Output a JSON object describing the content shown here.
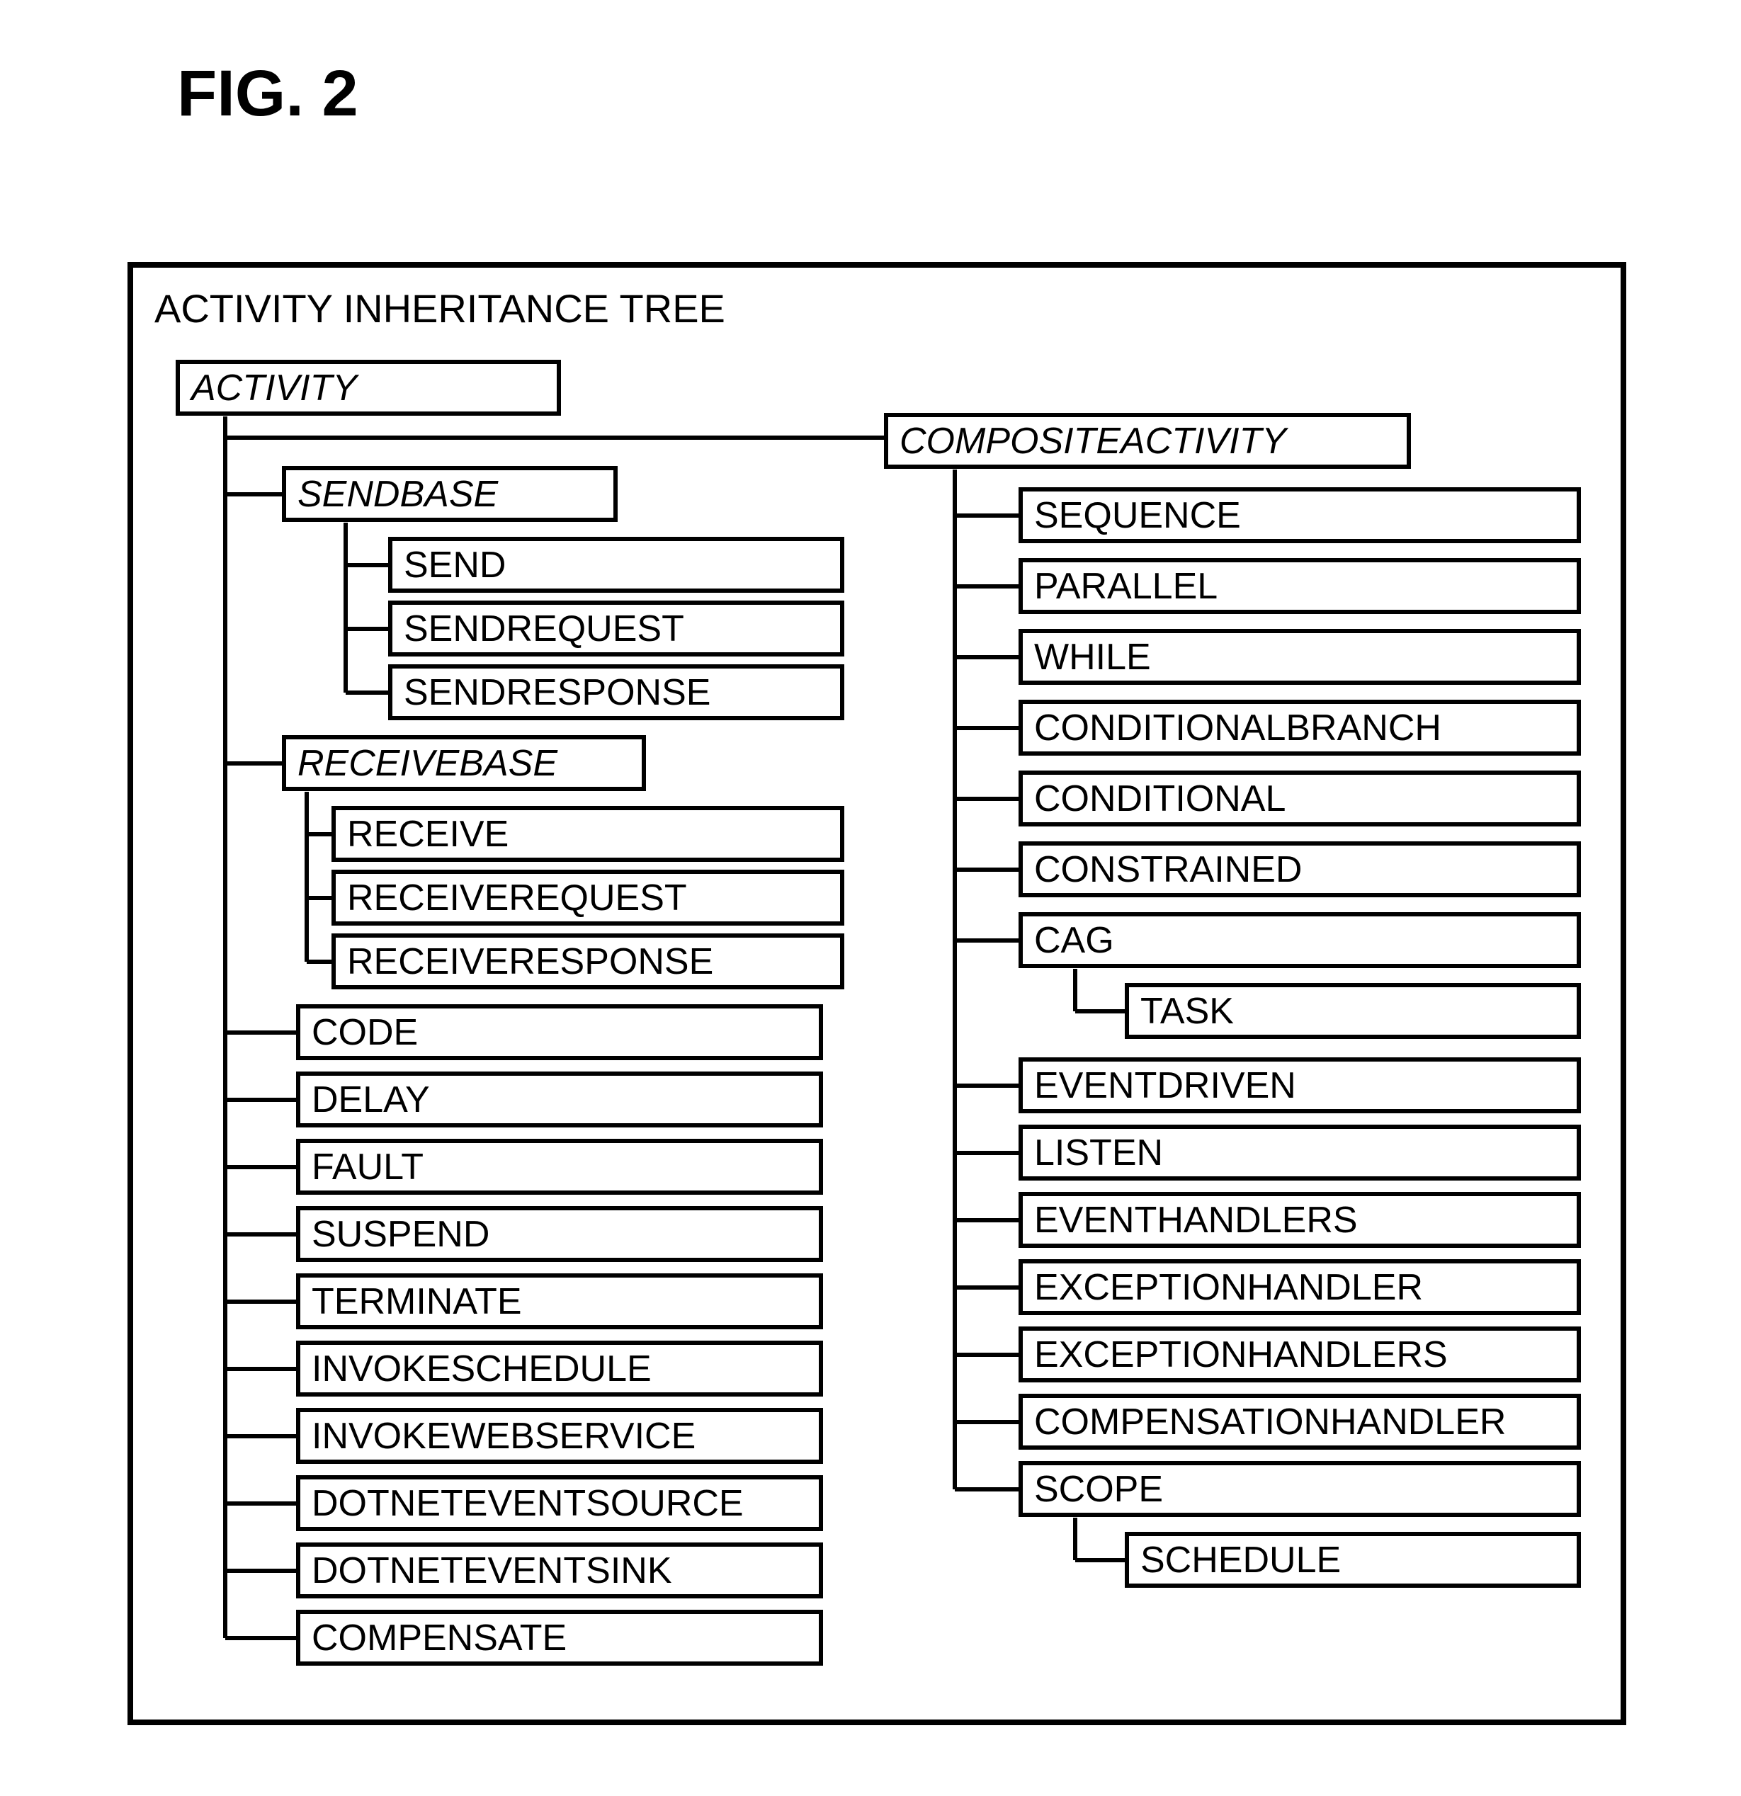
{
  "fig_label": "FIG. 2",
  "frame_title": "ACTIVITY INHERITANCE TREE",
  "activity": "ACTIVITY",
  "sendbase": "SENDBASE",
  "send": "SEND",
  "sendrequest": "SENDREQUEST",
  "sendresponse": "SENDRESPONSE",
  "receivebase": "RECEIVEBASE",
  "receive": "RECEIVE",
  "receiverequest": "RECEIVEREQUEST",
  "receiveresponse": "RECEIVERESPONSE",
  "code": "CODE",
  "delay": "DELAY",
  "fault": "FAULT",
  "suspend": "SUSPEND",
  "terminate": "TERMINATE",
  "invokeschedule": "INVOKESCHEDULE",
  "invokewebservice": "INVOKEWEBSERVICE",
  "dotneteventsource": "DOTNETEVENTSOURCE",
  "dotneteventsink": "DOTNETEVENTSINK",
  "compensate": "COMPENSATE",
  "compositeactivity": "COMPOSITEACTIVITY",
  "sequence": "SEQUENCE",
  "parallel": "PARALLEL",
  "while": "WHILE",
  "conditionalbranch": "CONDITIONALBRANCH",
  "conditional": "CONDITIONAL",
  "constrained": "CONSTRAINED",
  "cag": "CAG",
  "task": "TASK",
  "eventdriven": "EVENTDRIVEN",
  "listen": "LISTEN",
  "eventhandlers": "EVENTHANDLERS",
  "exceptionhandler": "EXCEPTIONHANDLER",
  "exceptionhandlers": "EXCEPTIONHANDLERS",
  "compensationhandler": "COMPENSATIONHANDLER",
  "scope": "SCOPE",
  "schedule": "SCHEDULE"
}
